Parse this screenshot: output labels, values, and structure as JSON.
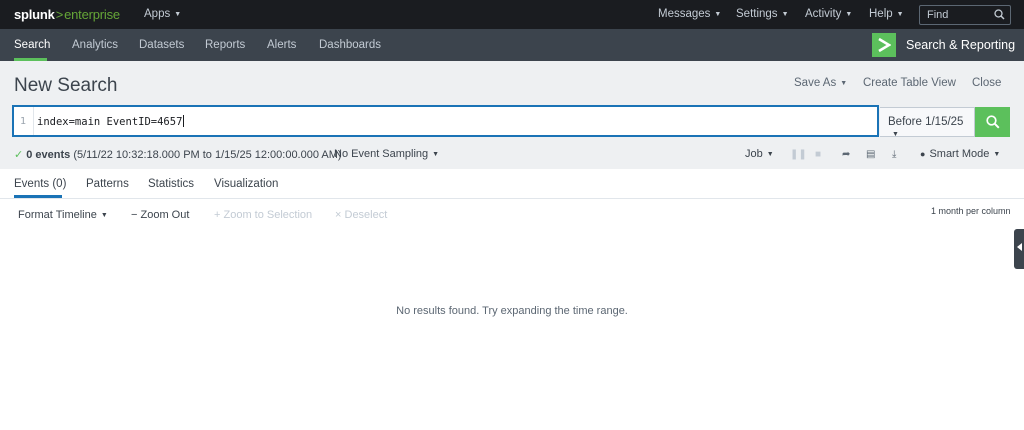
{
  "topbar": {
    "logo_main": "splunk",
    "logo_sep": ">",
    "logo_sub": "enterprise",
    "apps": "Apps",
    "messages": "Messages",
    "settings": "Settings",
    "activity": "Activity",
    "help": "Help",
    "find_placeholder": "Find"
  },
  "appbar": {
    "nav": [
      "Search",
      "Analytics",
      "Datasets",
      "Reports",
      "Alerts",
      "Dashboards"
    ],
    "app_name": "Search & Reporting",
    "accent": "#5cc05c"
  },
  "header": {
    "title": "New Search",
    "save_as": "Save As",
    "create_table_view": "Create Table View",
    "close": "Close"
  },
  "search": {
    "line_number": "1",
    "query": "index=main EventID=4657",
    "time_range": "Before 1/15/25"
  },
  "status": {
    "events": "0 events",
    "range": "(5/11/22 10:32:18.000 PM to 1/15/25 12:00:00.000 AM)",
    "sampling": "No Event Sampling",
    "job": "Job",
    "mode": "Smart Mode"
  },
  "tabs": [
    "Events (0)",
    "Patterns",
    "Statistics",
    "Visualization"
  ],
  "timeline": {
    "format": "Format Timeline",
    "zoom_out": "Zoom Out",
    "zoom_selection": "Zoom to Selection",
    "deselect": "Deselect",
    "scale": "1 month per column"
  },
  "results": {
    "empty_message": "No results found. Try expanding the time range."
  }
}
